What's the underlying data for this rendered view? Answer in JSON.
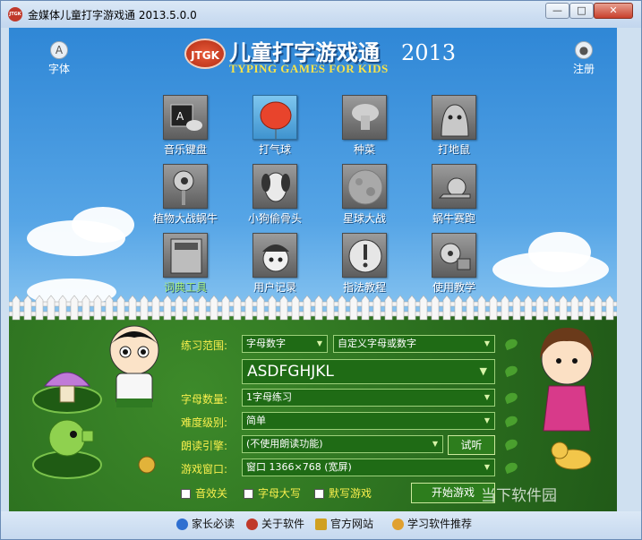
{
  "window": {
    "title": "金媒体儿童打字游戏通 2013.5.0.0",
    "app_icon_text": "JTGK",
    "controls": {
      "minimize": "—",
      "maximize": "□",
      "close": "✕"
    }
  },
  "header": {
    "left_button": {
      "label": "字体",
      "icon": "A"
    },
    "right_button": {
      "label": "注册",
      "icon": "lock-icon"
    },
    "logo": {
      "badge": "JTGK",
      "title_cn": "儿童打字游戏通",
      "year": "2013",
      "subtitle_en": "TYPING GAMES FOR KIDS"
    }
  },
  "games": [
    {
      "label": "音乐键盘",
      "icon": "keyboard-icon"
    },
    {
      "label": "打气球",
      "icon": "balloon-icon",
      "active": true
    },
    {
      "label": "种菜",
      "icon": "mushroom-icon"
    },
    {
      "label": "打地鼠",
      "icon": "mole-icon"
    },
    {
      "label": "植物大战蜗牛",
      "icon": "peashooter-icon"
    },
    {
      "label": "小狗偷骨头",
      "icon": "dog-icon"
    },
    {
      "label": "星球大战",
      "icon": "planet-icon"
    },
    {
      "label": "蜗牛赛跑",
      "icon": "snail-icon"
    },
    {
      "label": "词典工具",
      "icon": "dictionary-icon",
      "highlight": true
    },
    {
      "label": "用户记录",
      "icon": "police-icon"
    },
    {
      "label": "指法教程",
      "icon": "exclamation-icon"
    },
    {
      "label": "使用教学",
      "icon": "film-icon"
    }
  ],
  "settings": {
    "range_label": "练习范围:",
    "range_value": "字母数字",
    "range_custom": "自定义字母或数字",
    "letters": "ASDFGHJKL",
    "count_label": "字母数量:",
    "count_value": "1字母练习",
    "difficulty_label": "难度级别:",
    "difficulty_value": "简单",
    "voice_label": "朗读引擎:",
    "voice_value": "(不使用朗读功能)",
    "listen_button": "试听",
    "window_label": "游戏窗口:",
    "window_value": "窗口 1366×768 (宽屏)",
    "checkboxes": [
      "音效关",
      "字母大写",
      "默写游戏"
    ],
    "start_button": "开始游戏"
  },
  "statusbar": {
    "items": [
      "家长必读",
      "关于软件",
      "官方网站",
      "学习软件推荐"
    ],
    "watermark": "当下软件园"
  },
  "colors": {
    "title_bar": "#c2d6ee",
    "sky": "#3a8ddb",
    "grass": "#2a6d1e",
    "label_yellow": "#f8ef4d"
  }
}
